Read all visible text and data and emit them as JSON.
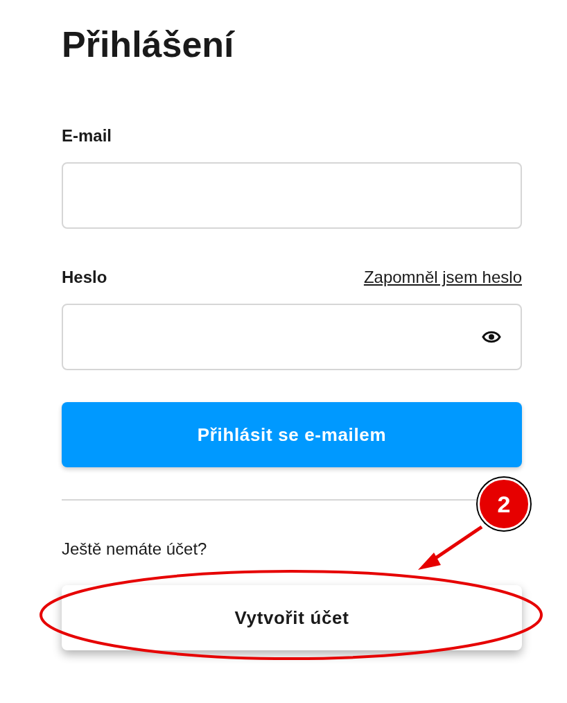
{
  "title": "Přihlášení",
  "email": {
    "label": "E-mail"
  },
  "password": {
    "label": "Heslo",
    "forgot_link": "Zapomněl jsem heslo"
  },
  "login_button": "Přihlásit se e-mailem",
  "signup_prompt": "Ještě nemáte účet?",
  "signup_button": "Vytvořit účet",
  "annotation": {
    "step": "2"
  }
}
